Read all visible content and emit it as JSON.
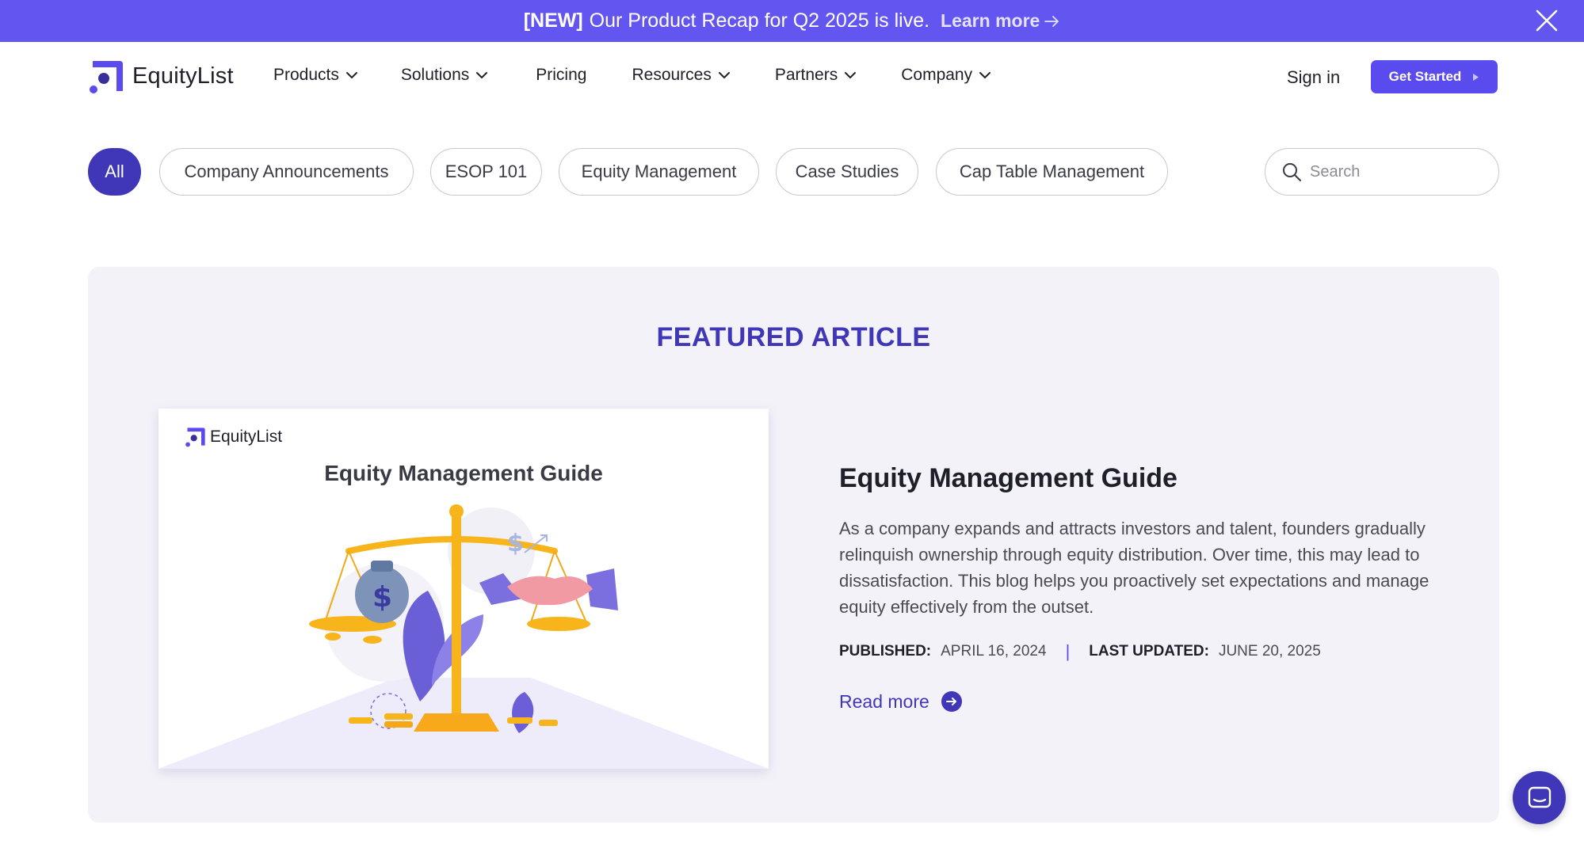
{
  "banner": {
    "tag": "[NEW]",
    "message": "Our Product Recap for Q2 2025 is live.",
    "link": "Learn more",
    "color": "#6355f0"
  },
  "header": {
    "logo_text": "EquityList",
    "nav": [
      {
        "label": "Products",
        "has_dropdown": true
      },
      {
        "label": "Solutions",
        "has_dropdown": true
      },
      {
        "label": "Pricing",
        "has_dropdown": false
      },
      {
        "label": "Resources",
        "has_dropdown": true
      },
      {
        "label": "Partners",
        "has_dropdown": true
      },
      {
        "label": "Company",
        "has_dropdown": true
      }
    ],
    "sign_in": "Sign in",
    "cta": "Get Started",
    "cta_color": "#5a4bef"
  },
  "filters": {
    "items": [
      "All",
      "Company Announcements",
      "ESOP 101",
      "Equity Management",
      "Case Studies",
      "Cap Table Management"
    ],
    "active": "All",
    "search_placeholder": "Search"
  },
  "featured": {
    "heading": "FEATURED ARTICLE",
    "card": {
      "logo_text": "EquityList",
      "title": "Equity Management Guide"
    },
    "title": "Equity Management Guide",
    "description": "As a company expands and attracts investors and talent, founders gradually relinquish ownership through equity distribution. Over time, this may lead to dissatisfaction. This blog helps you proactively set expectations and manage equity effectively from the outset.",
    "published_label": "PUBLISHED:",
    "published_date": "APRIL 16, 2024",
    "updated_label": "LAST UPDATED:",
    "updated_date": "JUNE 20, 2025",
    "read_more": "Read more",
    "accent": "#3f37b8"
  },
  "icons": {
    "close": "close-icon",
    "chevron": "chevron-down-icon",
    "search": "search-icon",
    "chat": "chat-icon"
  }
}
